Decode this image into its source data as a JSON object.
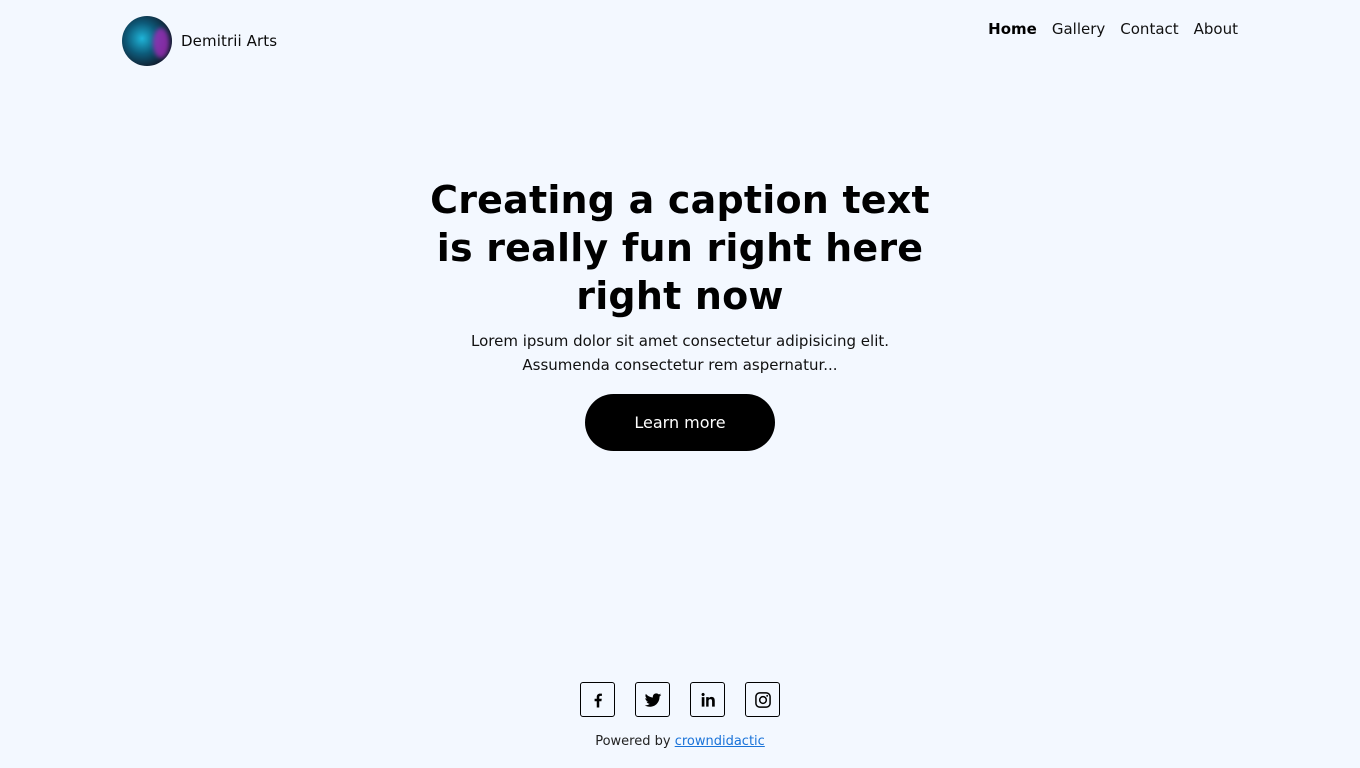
{
  "header": {
    "brand_name": "Demitrii Arts",
    "avatar_icon": "portrait-avatar",
    "nav": [
      {
        "label": "Home",
        "active": true
      },
      {
        "label": "Gallery",
        "active": false
      },
      {
        "label": "Contact",
        "active": false
      },
      {
        "label": "About",
        "active": false
      }
    ]
  },
  "hero": {
    "title": "Creating a caption text is really fun right here right now",
    "subtitle": "Lorem ipsum dolor sit amet consectetur adipisicing elit. Assumenda consectetur rem aspernatur...",
    "cta_label": "Learn more"
  },
  "footer": {
    "socials": [
      {
        "name": "facebook-icon"
      },
      {
        "name": "twitter-icon"
      },
      {
        "name": "linkedin-icon"
      },
      {
        "name": "instagram-icon"
      }
    ],
    "powered_prefix": "Powered by",
    "powered_link": "crowndidactic"
  },
  "colors": {
    "background": "#f3f8ff",
    "text": "#0b0b0b",
    "button": "#000000",
    "link": "#1a73d9"
  }
}
